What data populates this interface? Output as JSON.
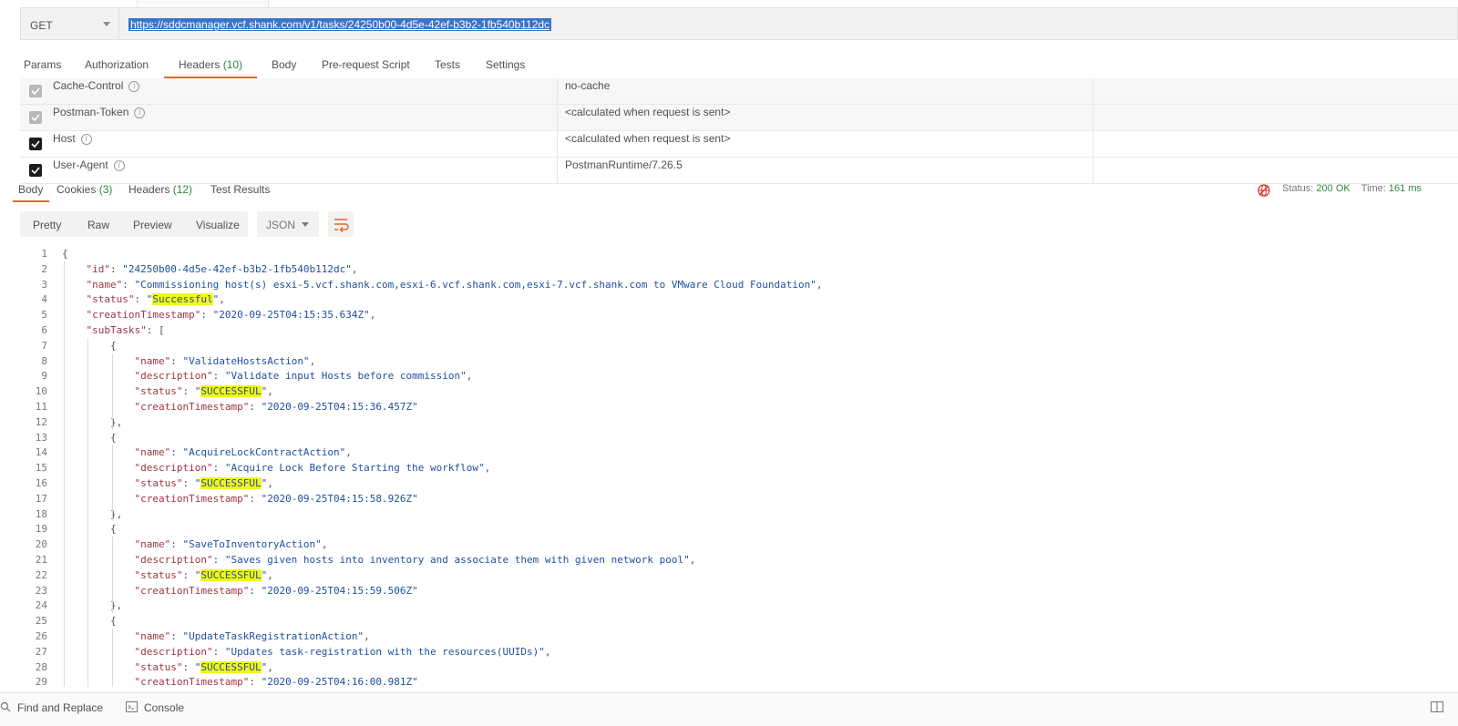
{
  "request": {
    "method": "GET",
    "url": "https://sddcmanager.vcf.shank.com/v1/tasks/24250b00-4d5e-42ef-b3b2-1fb540b112dc"
  },
  "request_tabs": {
    "params": "Params",
    "authorization": "Authorization",
    "headers_label": "Headers",
    "headers_count": "(10)",
    "body": "Body",
    "prerequest": "Pre-request Script",
    "tests": "Tests",
    "settings": "Settings"
  },
  "headers": [
    {
      "key": "Cache-Control",
      "value": "no-cache",
      "checked": true,
      "dim": true
    },
    {
      "key": "Postman-Token",
      "value": "<calculated when request is sent>",
      "checked": true,
      "dim": true
    },
    {
      "key": "Host",
      "value": "<calculated when request is sent>",
      "checked": true,
      "dim": false
    },
    {
      "key": "User-Agent",
      "value": "PostmanRuntime/7.26.5",
      "checked": true,
      "dim": false
    }
  ],
  "response_tabs": {
    "body": "Body",
    "cookies_label": "Cookies",
    "cookies_count": "(3)",
    "headers_label": "Headers",
    "headers_count": "(12)",
    "test_results": "Test Results"
  },
  "response_status": {
    "status_label": "Status:",
    "status_value": "200 OK",
    "time_label": "Time:",
    "time_value": "161 ms"
  },
  "view_modes": {
    "pretty": "Pretty",
    "raw": "Raw",
    "preview": "Preview",
    "visualize": "Visualize",
    "format": "JSON"
  },
  "code_lines": [
    {
      "n": "1",
      "text": "{"
    },
    {
      "n": "2",
      "text": "    \"id\": \"24250b00-4d5e-42ef-b3b2-1fb540b112dc\","
    },
    {
      "n": "3",
      "text": "    \"name\": \"Commissioning host(s) esxi-5.vcf.shank.com,esxi-6.vcf.shank.com,esxi-7.vcf.shank.com to VMware Cloud Foundation\","
    },
    {
      "n": "4",
      "text": "    \"status\": \"Successful\","
    },
    {
      "n": "5",
      "text": "    \"creationTimestamp\": \"2020-09-25T04:15:35.634Z\","
    },
    {
      "n": "6",
      "text": "    \"subTasks\": ["
    },
    {
      "n": "7",
      "text": "        {"
    },
    {
      "n": "8",
      "text": "            \"name\": \"ValidateHostsAction\","
    },
    {
      "n": "9",
      "text": "            \"description\": \"Validate input Hosts before commission\","
    },
    {
      "n": "10",
      "text": "            \"status\": \"SUCCESSFUL\","
    },
    {
      "n": "11",
      "text": "            \"creationTimestamp\": \"2020-09-25T04:15:36.457Z\""
    },
    {
      "n": "12",
      "text": "        },"
    },
    {
      "n": "13",
      "text": "        {"
    },
    {
      "n": "14",
      "text": "            \"name\": \"AcquireLockContractAction\","
    },
    {
      "n": "15",
      "text": "            \"description\": \"Acquire Lock Before Starting the workflow\","
    },
    {
      "n": "16",
      "text": "            \"status\": \"SUCCESSFUL\","
    },
    {
      "n": "17",
      "text": "            \"creationTimestamp\": \"2020-09-25T04:15:58.926Z\""
    },
    {
      "n": "18",
      "text": "        },"
    },
    {
      "n": "19",
      "text": "        {"
    },
    {
      "n": "20",
      "text": "            \"name\": \"SaveToInventoryAction\","
    },
    {
      "n": "21",
      "text": "            \"description\": \"Saves given hosts into inventory and associate them with given network pool\","
    },
    {
      "n": "22",
      "text": "            \"status\": \"SUCCESSFUL\","
    },
    {
      "n": "23",
      "text": "            \"creationTimestamp\": \"2020-09-25T04:15:59.506Z\""
    },
    {
      "n": "24",
      "text": "        },"
    },
    {
      "n": "25",
      "text": "        {"
    },
    {
      "n": "26",
      "text": "            \"name\": \"UpdateTaskRegistrationAction\","
    },
    {
      "n": "27",
      "text": "            \"description\": \"Updates task-registration with the resources(UUIDs)\","
    },
    {
      "n": "28",
      "text": "            \"status\": \"SUCCESSFUL\","
    },
    {
      "n": "29",
      "text": "            \"creationTimestamp\": \"2020-09-25T04:16:00.981Z\""
    }
  ],
  "bottom_bar": {
    "find_replace": "Find and Replace",
    "console": "Console"
  },
  "colors": {
    "accent": "#e8652a",
    "ok_green": "#2e8a3e",
    "highlight": "#f3f51e",
    "url_selection": "#3a73c9"
  }
}
